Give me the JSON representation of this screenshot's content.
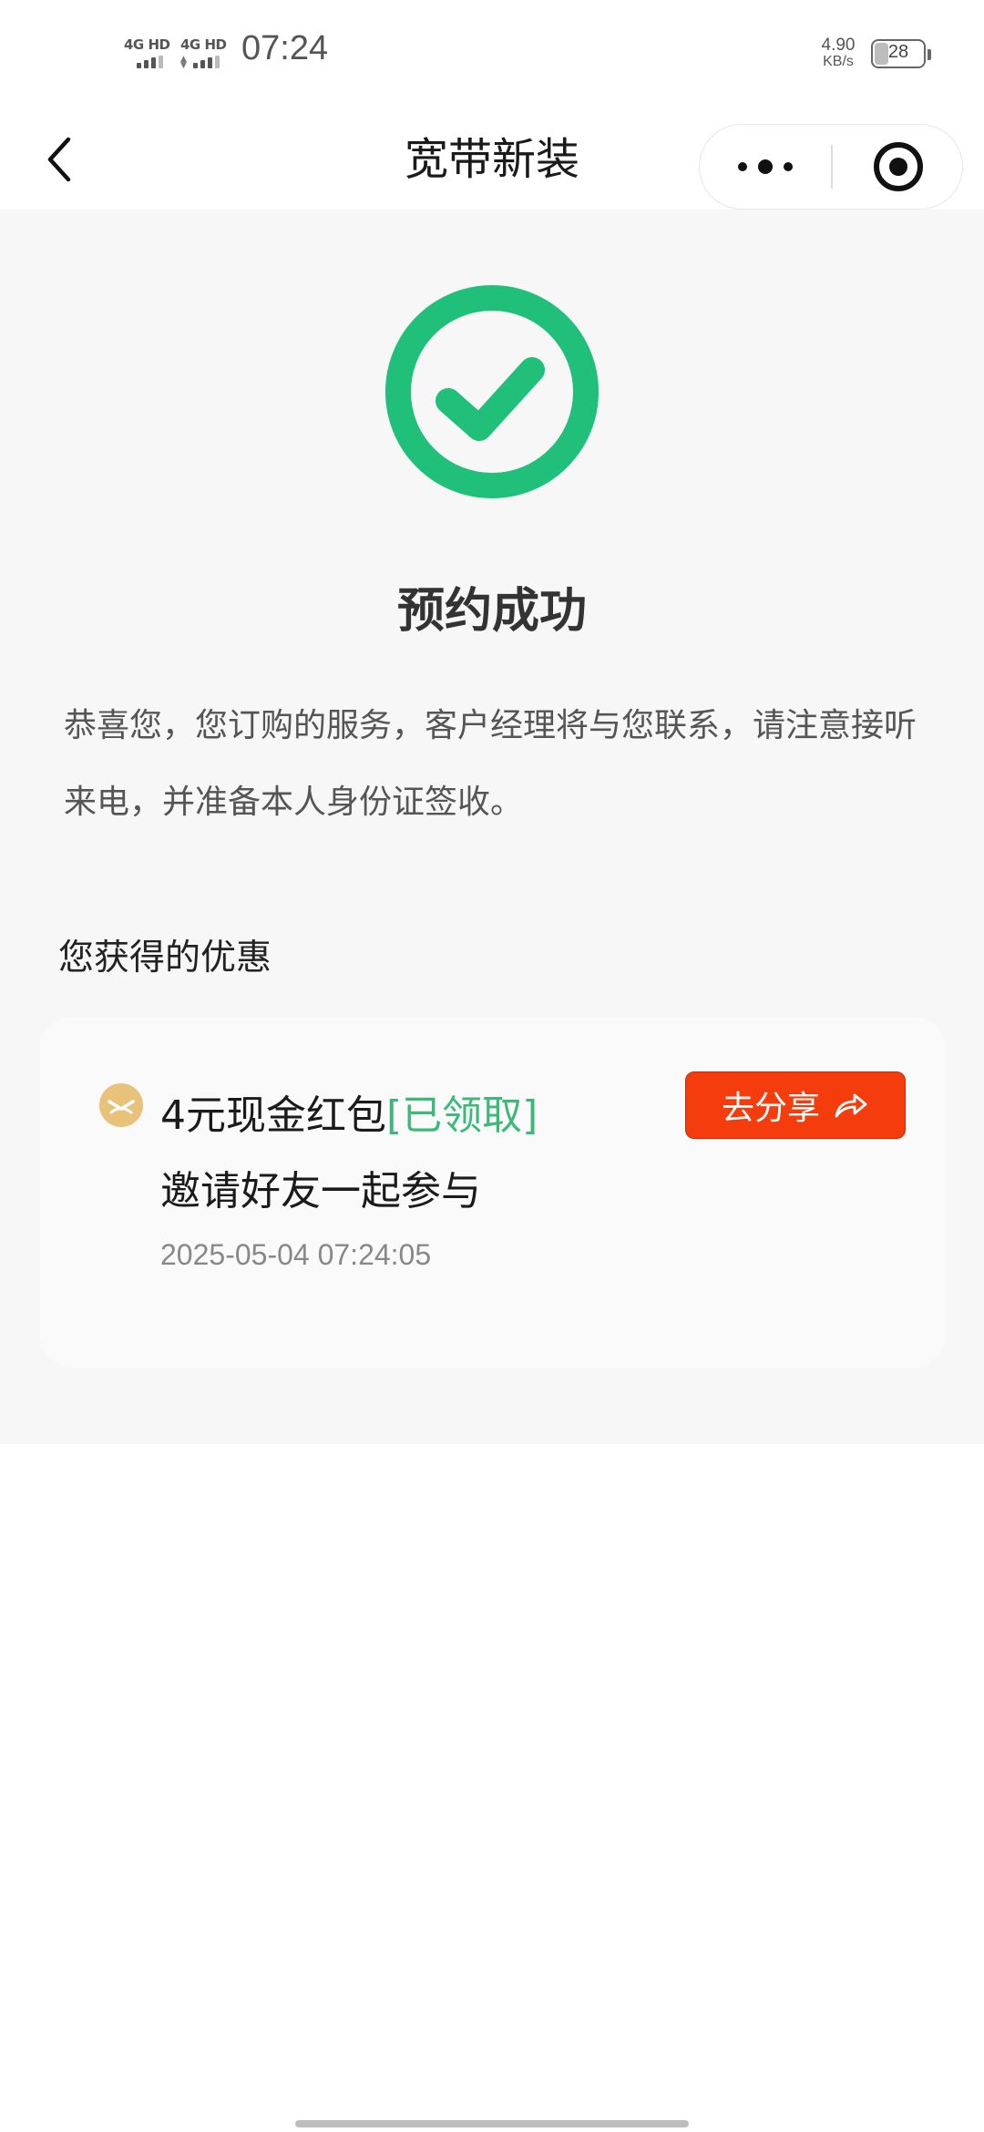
{
  "status_bar": {
    "sim1_network": "4G HD",
    "sim2_network": "4G HD",
    "time": "07:24",
    "net_speed_value": "4.90",
    "net_speed_unit": "KB/s",
    "battery_level": "28"
  },
  "nav": {
    "title": "宽带新装"
  },
  "result": {
    "title": "预约成功",
    "description": "恭喜您，您订购的服务，客户经理将与您联系，请注意接听来电，并准备本人身份证签收。"
  },
  "benefits": {
    "section_title": "您获得的优惠",
    "coupon": {
      "name": "4元现金红包",
      "status": "[已领取]",
      "subtitle": "邀请好友一起参与",
      "time": "2025-05-04 07:24:05",
      "share_label": "去分享"
    }
  },
  "colors": {
    "success_green": "#20c07a",
    "status_green": "#3cb878",
    "share_button_red": "#f43c0c",
    "coupon_icon_gold": "#e8c27a"
  }
}
